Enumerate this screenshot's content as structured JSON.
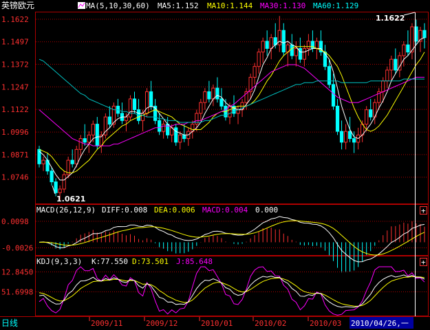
{
  "instrument": "英镑欧元",
  "colors": {
    "up": "#ff3030",
    "down": "#00ffff",
    "ma5": "#ffffff",
    "ma10": "#ffff00",
    "ma30": "#ff00ff",
    "ma60": "#00c0c0",
    "grid": "#b00000",
    "axis_text": "#ff3030",
    "label_white": "#ffffff",
    "bottom_highlight": "#0000a0"
  },
  "main_header": {
    "ma_params": "MA(5,10,30,60)",
    "ma5": "MA5:1.152",
    "ma10": "MA10:1.144",
    "ma30": "MA30:1.130",
    "ma60": "MA60:1.129",
    "icon": "indicator-icon"
  },
  "macd_header": {
    "params": "MACD(26,12,9)",
    "diff": "DIFF:0.008",
    "dea": "DEA:0.006",
    "macd": "MACD:0.004",
    "extra": "0.000"
  },
  "kdj_header": {
    "params": "KDJ(9,3,3)",
    "k": "K:77.550",
    "d": "D:73.501",
    "j": "J:85.648"
  },
  "annotations": {
    "high": "1.1622",
    "low": "1.0621"
  },
  "bottom_bar": {
    "period": "日线",
    "dates": [
      "2009/11",
      "2009/12",
      "2010/01",
      "2010/02",
      "2010/03"
    ],
    "cursor_date": "2010/04/26,一"
  },
  "panel_buttons": {
    "macd": "+",
    "kdj": "+"
  },
  "chart_data": [
    {
      "type": "candlestick",
      "y_ticks": [
        "1.1622",
        "1.1497",
        "1.1372",
        "1.1247",
        "1.1122",
        "1.0996",
        "1.0871",
        "1.0746"
      ],
      "ylim": [
        1.06,
        1.166
      ],
      "ohlc": [
        [
          1.09,
          1.092,
          1.08,
          1.082
        ],
        [
          1.082,
          1.086,
          1.078,
          1.084
        ],
        [
          1.084,
          1.088,
          1.076,
          1.078
        ],
        [
          1.078,
          1.08,
          1.07,
          1.072
        ],
        [
          1.072,
          1.074,
          1.064,
          1.066
        ],
        [
          1.066,
          1.07,
          1.062,
          1.068
        ],
        [
          1.068,
          1.078,
          1.066,
          1.076
        ],
        [
          1.076,
          1.086,
          1.074,
          1.084
        ],
        [
          1.084,
          1.09,
          1.08,
          1.082
        ],
        [
          1.082,
          1.092,
          1.08,
          1.09
        ],
        [
          1.09,
          1.098,
          1.086,
          1.096
        ],
        [
          1.096,
          1.104,
          1.092,
          1.094
        ],
        [
          1.094,
          1.1,
          1.088,
          1.098
        ],
        [
          1.098,
          1.106,
          1.094,
          1.104
        ],
        [
          1.104,
          1.108,
          1.09,
          1.092
        ],
        [
          1.092,
          1.1,
          1.088,
          1.098
        ],
        [
          1.098,
          1.11,
          1.096,
          1.108
        ],
        [
          1.108,
          1.114,
          1.102,
          1.104
        ],
        [
          1.104,
          1.116,
          1.102,
          1.114
        ],
        [
          1.114,
          1.118,
          1.108,
          1.11
        ],
        [
          1.11,
          1.116,
          1.104,
          1.106
        ],
        [
          1.106,
          1.11,
          1.1,
          1.108
        ],
        [
          1.108,
          1.12,
          1.106,
          1.118
        ],
        [
          1.118,
          1.122,
          1.11,
          1.112
        ],
        [
          1.112,
          1.118,
          1.104,
          1.106
        ],
        [
          1.106,
          1.112,
          1.1,
          1.11
        ],
        [
          1.11,
          1.124,
          1.108,
          1.122
        ],
        [
          1.122,
          1.128,
          1.112,
          1.114
        ],
        [
          1.114,
          1.118,
          1.104,
          1.106
        ],
        [
          1.106,
          1.11,
          1.098,
          1.1
        ],
        [
          1.1,
          1.106,
          1.096,
          1.104
        ],
        [
          1.104,
          1.108,
          1.096,
          1.098
        ],
        [
          1.098,
          1.104,
          1.094,
          1.102
        ],
        [
          1.102,
          1.104,
          1.092,
          1.094
        ],
        [
          1.094,
          1.1,
          1.09,
          1.098
        ],
        [
          1.098,
          1.104,
          1.094,
          1.096
        ],
        [
          1.096,
          1.102,
          1.092,
          1.1
        ],
        [
          1.1,
          1.106,
          1.096,
          1.104
        ],
        [
          1.104,
          1.112,
          1.1,
          1.11
        ],
        [
          1.11,
          1.118,
          1.106,
          1.116
        ],
        [
          1.116,
          1.124,
          1.112,
          1.122
        ],
        [
          1.122,
          1.128,
          1.116,
          1.118
        ],
        [
          1.118,
          1.126,
          1.114,
          1.124
        ],
        [
          1.124,
          1.13,
          1.116,
          1.118
        ],
        [
          1.118,
          1.124,
          1.112,
          1.114
        ],
        [
          1.114,
          1.118,
          1.106,
          1.108
        ],
        [
          1.108,
          1.116,
          1.104,
          1.114
        ],
        [
          1.114,
          1.12,
          1.108,
          1.11
        ],
        [
          1.11,
          1.114,
          1.104,
          1.112
        ],
        [
          1.112,
          1.118,
          1.108,
          1.116
        ],
        [
          1.116,
          1.124,
          1.112,
          1.122
        ],
        [
          1.122,
          1.132,
          1.118,
          1.13
        ],
        [
          1.13,
          1.138,
          1.126,
          1.136
        ],
        [
          1.136,
          1.146,
          1.132,
          1.144
        ],
        [
          1.144,
          1.152,
          1.138,
          1.15
        ],
        [
          1.15,
          1.156,
          1.142,
          1.146
        ],
        [
          1.146,
          1.154,
          1.14,
          1.152
        ],
        [
          1.152,
          1.16,
          1.146,
          1.148
        ],
        [
          1.148,
          1.164,
          1.144,
          1.156
        ],
        [
          1.156,
          1.16,
          1.142,
          1.144
        ],
        [
          1.144,
          1.15,
          1.136,
          1.148
        ],
        [
          1.148,
          1.154,
          1.14,
          1.142
        ],
        [
          1.142,
          1.15,
          1.136,
          1.146
        ],
        [
          1.146,
          1.152,
          1.138,
          1.14
        ],
        [
          1.14,
          1.148,
          1.136,
          1.146
        ],
        [
          1.146,
          1.154,
          1.142,
          1.15
        ],
        [
          1.15,
          1.156,
          1.144,
          1.146
        ],
        [
          1.146,
          1.152,
          1.14,
          1.15
        ],
        [
          1.15,
          1.156,
          1.142,
          1.144
        ],
        [
          1.144,
          1.148,
          1.134,
          1.136
        ],
        [
          1.136,
          1.14,
          1.124,
          1.126
        ],
        [
          1.126,
          1.132,
          1.112,
          1.114
        ],
        [
          1.114,
          1.118,
          1.098,
          1.1
        ],
        [
          1.1,
          1.106,
          1.09,
          1.094
        ],
        [
          1.094,
          1.104,
          1.09,
          1.1
        ],
        [
          1.1,
          1.108,
          1.094,
          1.096
        ],
        [
          1.096,
          1.1,
          1.088,
          1.094
        ],
        [
          1.094,
          1.102,
          1.09,
          1.098
        ],
        [
          1.098,
          1.106,
          1.094,
          1.104
        ],
        [
          1.104,
          1.114,
          1.1,
          1.112
        ],
        [
          1.112,
          1.118,
          1.106,
          1.108
        ],
        [
          1.108,
          1.118,
          1.104,
          1.116
        ],
        [
          1.116,
          1.124,
          1.112,
          1.122
        ],
        [
          1.122,
          1.13,
          1.116,
          1.128
        ],
        [
          1.128,
          1.136,
          1.124,
          1.134
        ],
        [
          1.134,
          1.142,
          1.128,
          1.14
        ],
        [
          1.14,
          1.146,
          1.132,
          1.134
        ],
        [
          1.134,
          1.144,
          1.13,
          1.142
        ],
        [
          1.142,
          1.15,
          1.136,
          1.148
        ],
        [
          1.148,
          1.156,
          1.142,
          1.144
        ],
        [
          1.144,
          1.16,
          1.14,
          1.158
        ],
        [
          1.158,
          1.162,
          1.148,
          1.15
        ],
        [
          1.15,
          1.158,
          1.144,
          1.156
        ],
        [
          1.156,
          1.16,
          1.146,
          1.152
        ]
      ],
      "ma": {
        "ma5": {
          "name": "MA5",
          "values": [
            1.089,
            1.087,
            1.084,
            1.08,
            1.076,
            1.073,
            1.073,
            1.075,
            1.077,
            1.081,
            1.086,
            1.09,
            1.093,
            1.096,
            1.097,
            1.097,
            1.1,
            1.102,
            1.105,
            1.107,
            1.108,
            1.108,
            1.111,
            1.111,
            1.11,
            1.11,
            1.113,
            1.114,
            1.113,
            1.11,
            1.107,
            1.104,
            1.102,
            1.1,
            1.099,
            1.098,
            1.098,
            1.1,
            1.102,
            1.105,
            1.11,
            1.114,
            1.118,
            1.12,
            1.119,
            1.116,
            1.114,
            1.113,
            1.112,
            1.112,
            1.115,
            1.118,
            1.123,
            1.13,
            1.137,
            1.141,
            1.146,
            1.148,
            1.15,
            1.149,
            1.15,
            1.148,
            1.147,
            1.144,
            1.144,
            1.145,
            1.146,
            1.146,
            1.146,
            1.143,
            1.14,
            1.133,
            1.124,
            1.114,
            1.107,
            1.101,
            1.097,
            1.096,
            1.098,
            1.101,
            1.104,
            1.108,
            1.113,
            1.117,
            1.122,
            1.128,
            1.132,
            1.136,
            1.14,
            1.142,
            1.145,
            1.148,
            1.151,
            1.152
          ]
        },
        "ma10": {
          "name": "MA10",
          "values": [
            1.09,
            1.089,
            1.088,
            1.086,
            1.083,
            1.08,
            1.078,
            1.077,
            1.077,
            1.078,
            1.08,
            1.082,
            1.084,
            1.087,
            1.09,
            1.092,
            1.095,
            1.097,
            1.099,
            1.101,
            1.103,
            1.104,
            1.106,
            1.107,
            1.108,
            1.109,
            1.11,
            1.111,
            1.112,
            1.111,
            1.11,
            1.109,
            1.108,
            1.106,
            1.104,
            1.103,
            1.102,
            1.101,
            1.101,
            1.101,
            1.103,
            1.105,
            1.108,
            1.11,
            1.111,
            1.111,
            1.112,
            1.113,
            1.114,
            1.114,
            1.114,
            1.115,
            1.117,
            1.12,
            1.124,
            1.128,
            1.131,
            1.135,
            1.139,
            1.142,
            1.144,
            1.146,
            1.147,
            1.147,
            1.147,
            1.147,
            1.147,
            1.146,
            1.145,
            1.144,
            1.142,
            1.139,
            1.136,
            1.131,
            1.125,
            1.119,
            1.113,
            1.108,
            1.104,
            1.101,
            1.1,
            1.101,
            1.103,
            1.106,
            1.109,
            1.113,
            1.117,
            1.121,
            1.125,
            1.129,
            1.133,
            1.137,
            1.14,
            1.144
          ]
        },
        "ma30": {
          "name": "MA30",
          "values": [
            1.112,
            1.11,
            1.108,
            1.106,
            1.104,
            1.102,
            1.1,
            1.098,
            1.096,
            1.095,
            1.094,
            1.093,
            1.093,
            1.092,
            1.092,
            1.092,
            1.092,
            1.092,
            1.093,
            1.093,
            1.094,
            1.095,
            1.096,
            1.097,
            1.098,
            1.099,
            1.1,
            1.101,
            1.102,
            1.102,
            1.103,
            1.103,
            1.103,
            1.104,
            1.104,
            1.104,
            1.105,
            1.105,
            1.106,
            1.106,
            1.107,
            1.108,
            1.109,
            1.11,
            1.111,
            1.112,
            1.114,
            1.115,
            1.117,
            1.119,
            1.121,
            1.123,
            1.125,
            1.127,
            1.129,
            1.131,
            1.133,
            1.134,
            1.135,
            1.136,
            1.137,
            1.137,
            1.137,
            1.136,
            1.135,
            1.133,
            1.131,
            1.129,
            1.127,
            1.125,
            1.123,
            1.121,
            1.119,
            1.118,
            1.117,
            1.116,
            1.116,
            1.116,
            1.117,
            1.118,
            1.119,
            1.12,
            1.121,
            1.122,
            1.123,
            1.124,
            1.125,
            1.126,
            1.127,
            1.128,
            1.129,
            1.13,
            1.13,
            1.13
          ]
        },
        "ma60": {
          "name": "MA60",
          "values": [
            1.14,
            1.139,
            1.137,
            1.135,
            1.133,
            1.131,
            1.129,
            1.127,
            1.125,
            1.123,
            1.121,
            1.12,
            1.118,
            1.117,
            1.116,
            1.115,
            1.114,
            1.113,
            1.112,
            1.112,
            1.111,
            1.111,
            1.11,
            1.11,
            1.109,
            1.109,
            1.108,
            1.108,
            1.108,
            1.107,
            1.107,
            1.106,
            1.106,
            1.106,
            1.105,
            1.105,
            1.105,
            1.105,
            1.105,
            1.105,
            1.106,
            1.106,
            1.107,
            1.108,
            1.109,
            1.109,
            1.11,
            1.111,
            1.112,
            1.113,
            1.114,
            1.115,
            1.116,
            1.117,
            1.118,
            1.119,
            1.12,
            1.121,
            1.122,
            1.123,
            1.124,
            1.125,
            1.126,
            1.126,
            1.127,
            1.127,
            1.127,
            1.128,
            1.128,
            1.128,
            1.128,
            1.128,
            1.128,
            1.127,
            1.127,
            1.127,
            1.127,
            1.127,
            1.127,
            1.127,
            1.128,
            1.128,
            1.128,
            1.128,
            1.128,
            1.128,
            1.128,
            1.128,
            1.129,
            1.129,
            1.129,
            1.129,
            1.129,
            1.129
          ]
        }
      }
    },
    {
      "type": "bar",
      "name": "MACD",
      "y_ticks": [
        "0.0098",
        "-0.0026"
      ],
      "ylim": [
        -0.006,
        0.013
      ]
    },
    {
      "type": "line",
      "name": "KDJ",
      "y_ticks": [
        "12.8450",
        "51.6998"
      ],
      "ylim": [
        -10,
        110
      ]
    }
  ]
}
